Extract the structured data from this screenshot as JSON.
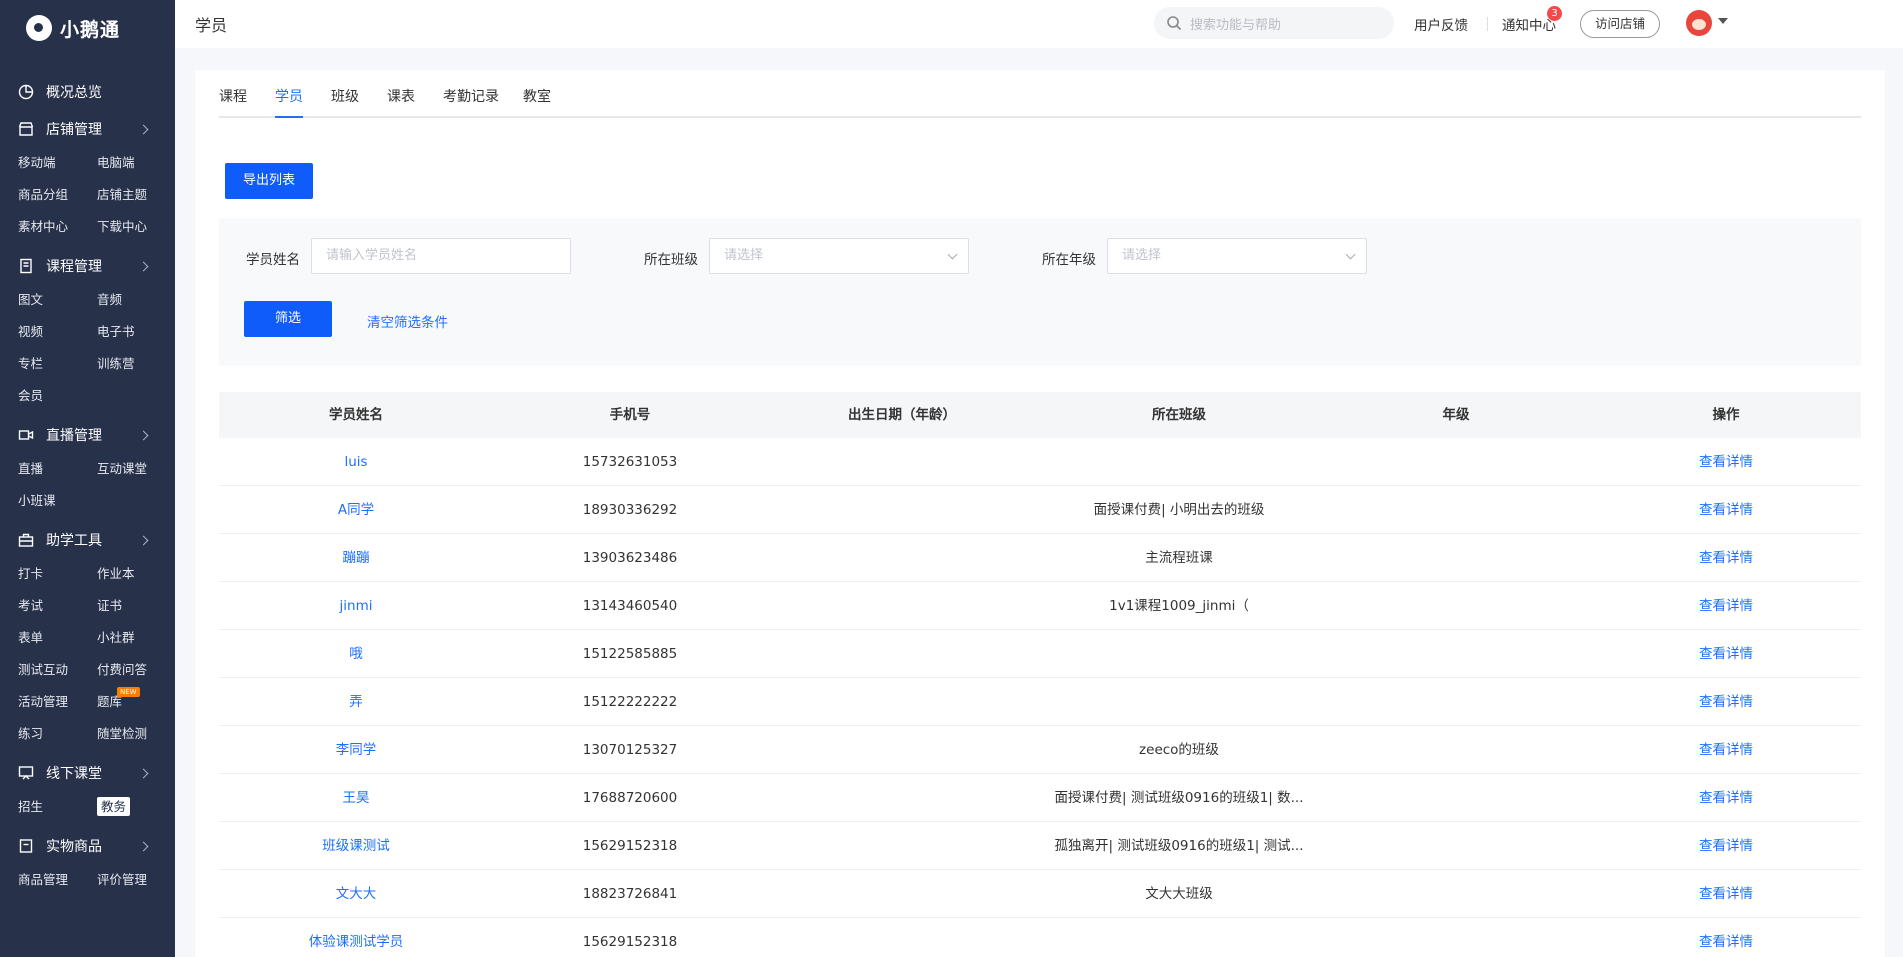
{
  "app": {
    "brand": "小鹅通",
    "page_title": "学员"
  },
  "header": {
    "search_placeholder": "搜索功能与帮助",
    "feedback": "用户反馈",
    "notify": "通知中心",
    "notify_count": "3",
    "visit_store": "访问店铺"
  },
  "sidebar": {
    "overview": "概况总览",
    "groups": [
      {
        "title": "店铺管理",
        "icon": "store-icon",
        "items": [
          "移动端",
          "电脑端",
          "商品分组",
          "店铺主题",
          "素材中心",
          "下载中心"
        ]
      },
      {
        "title": "课程管理",
        "icon": "book-icon",
        "items": [
          "图文",
          "音频",
          "视频",
          "电子书",
          "专栏",
          "训练营",
          "会员"
        ]
      },
      {
        "title": "直播管理",
        "icon": "video-icon",
        "items": [
          "直播",
          "互动课堂",
          "小班课"
        ]
      },
      {
        "title": "助学工具",
        "icon": "toolbox-icon",
        "items": [
          "打卡",
          "作业本",
          "考试",
          "证书",
          "表单",
          "小社群",
          "测试互动",
          "付费问答",
          "活动管理",
          "题库",
          "练习",
          "随堂检测"
        ]
      },
      {
        "title": "线下课堂",
        "icon": "classroom-icon",
        "items": [
          "招生",
          "教务"
        ]
      },
      {
        "title": "实物商品",
        "icon": "goods-icon",
        "items": [
          "商品管理",
          "评价管理"
        ]
      }
    ],
    "new_badge": "NEW",
    "active_item": "教务"
  },
  "tabs": [
    "课程",
    "学员",
    "班级",
    "课表",
    "考勤记录",
    "教室"
  ],
  "active_tab": "学员",
  "toolbar": {
    "export_label": "导出列表"
  },
  "filters": {
    "name_label": "学员姓名",
    "name_placeholder": "请输入学员姓名",
    "class_label": "所在班级",
    "class_placeholder": "请选择",
    "grade_label": "所在年级",
    "grade_placeholder": "请选择",
    "filter_button": "筛选",
    "clear_link": "清空筛选条件"
  },
  "table": {
    "columns": [
      "学员姓名",
      "手机号",
      "出生日期（年龄）",
      "所在班级",
      "年级",
      "操作"
    ],
    "action_label": "查看详情",
    "rows": [
      {
        "name": "luis",
        "phone": "15732631053",
        "birth": "",
        "class": "",
        "grade": ""
      },
      {
        "name": "A同学",
        "phone": "18930336292",
        "birth": "",
        "class": "面授课付费| 小明出去的班级",
        "grade": ""
      },
      {
        "name": "蹦蹦",
        "phone": "13903623486",
        "birth": "",
        "class": "主流程班课",
        "grade": ""
      },
      {
        "name": "jinmi",
        "phone": "13143460540",
        "birth": "",
        "class": "1v1课程1009_jinmi（",
        "grade": ""
      },
      {
        "name": "哦",
        "phone": "15122585885",
        "birth": "",
        "class": "",
        "grade": ""
      },
      {
        "name": "弄",
        "phone": "15122222222",
        "birth": "",
        "class": "",
        "grade": ""
      },
      {
        "name": "李同学",
        "phone": "13070125327",
        "birth": "",
        "class": "zeeco的班级",
        "grade": ""
      },
      {
        "name": "王昊",
        "phone": "17688720600",
        "birth": "",
        "class": "面授课付费| 测试班级0916的班级1| 数...",
        "grade": ""
      },
      {
        "name": "班级课测试",
        "phone": "15629152318",
        "birth": "",
        "class": "孤独离开| 测试班级0916的班级1| 测试...",
        "grade": ""
      },
      {
        "name": "文大大",
        "phone": "18823726841",
        "birth": "",
        "class": "文大大班级",
        "grade": ""
      },
      {
        "name": "体验课测试学员",
        "phone": "15629152318",
        "birth": "",
        "class": "",
        "grade": ""
      }
    ]
  },
  "colors": {
    "primary": "#105cfb",
    "link": "#1e6fff",
    "sidebar_bg": "#27314a"
  }
}
